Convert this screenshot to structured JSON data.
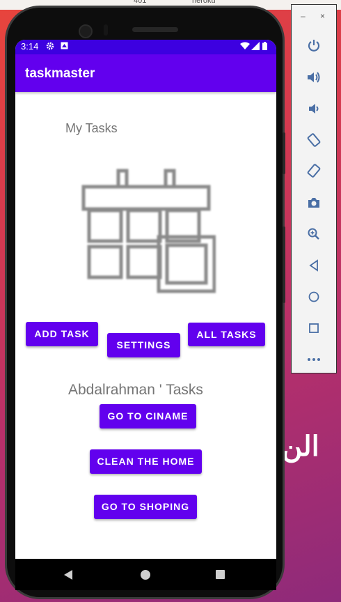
{
  "window": {
    "top_left_label": "401",
    "top_right_label": "heroku",
    "background_text": "الن"
  },
  "status_bar": {
    "time": "3:14"
  },
  "app": {
    "title": "taskmaster",
    "heading": "My Tasks",
    "buttons": {
      "add_task": "ADD TASK",
      "settings": "SETTINGS",
      "all_tasks": "ALL TASKS"
    },
    "user_tasks_heading": "Abdalrahman ' Tasks",
    "tasks": [
      "GO TO CINAME",
      "CLEAN THE HOME",
      "GO TO SHOPING"
    ]
  },
  "emulator_panel": {
    "minimize": "–",
    "close": "×",
    "tools": [
      "power-icon",
      "volume-up-icon",
      "volume-down-icon",
      "rotate-left-icon",
      "rotate-right-icon",
      "camera-icon",
      "zoom-icon",
      "back-icon",
      "home-icon",
      "overview-icon",
      "more-icon"
    ]
  },
  "colors": {
    "primary": "#6200ee",
    "primary_dark": "#3d00e0",
    "panel_icon": "#4a6fa5"
  }
}
